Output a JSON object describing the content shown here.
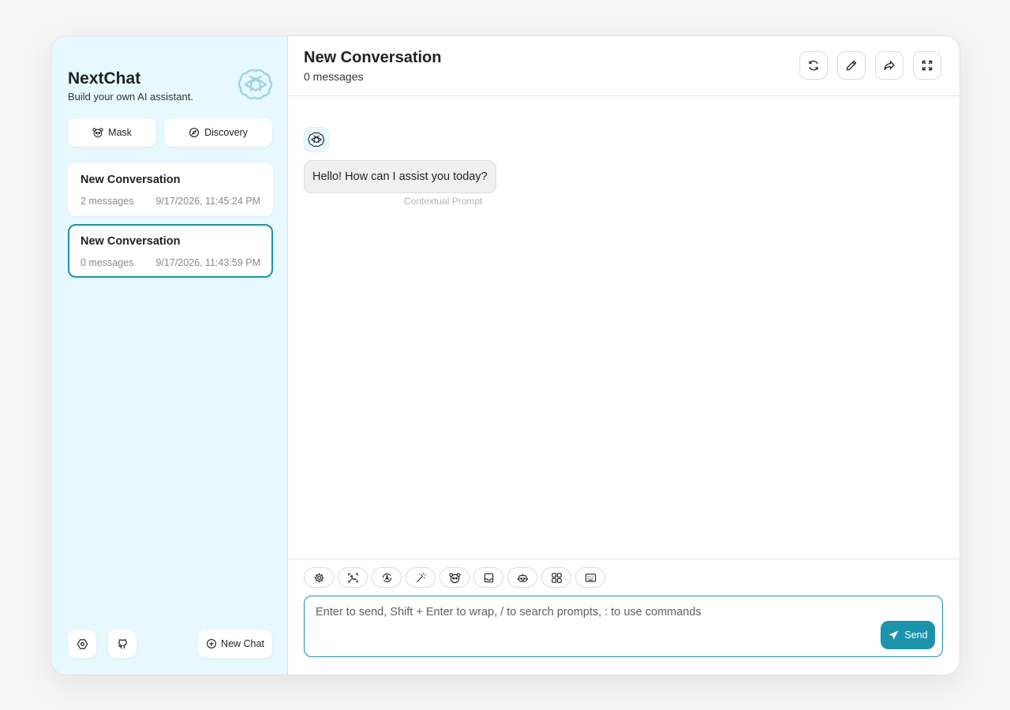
{
  "sidebar": {
    "brand_title": "NextChat",
    "brand_subtitle": "Build your own AI assistant.",
    "brand_icon": "openai-logo-icon",
    "mask_label": "Mask",
    "discovery_label": "Discovery",
    "chats": [
      {
        "title": "New Conversation",
        "count": "2 messages",
        "date": "9/17/2026, 11:45:24 PM",
        "selected": false
      },
      {
        "title": "New Conversation",
        "count": "0 messages",
        "date": "9/17/2026, 11:43:59 PM",
        "selected": true
      }
    ],
    "settings_icon": "settings-icon",
    "github_icon": "github-icon",
    "new_chat_label": "New Chat"
  },
  "header": {
    "title": "New Conversation",
    "subtitle": "0 messages",
    "buttons": [
      "refresh-icon",
      "edit-icon",
      "share-icon",
      "fullscreen-icon"
    ]
  },
  "messages": [
    {
      "role": "assistant",
      "text": "Hello! How can I assist you today?",
      "label": "Contextual Prompt"
    }
  ],
  "input": {
    "placeholder": "Enter to send, Shift + Enter to wrap, / to search prompts, : to use commands",
    "send_label": "Send",
    "toolbar": [
      "settings-icon",
      "image-icon",
      "auto-theme-icon",
      "prompt-magic-icon",
      "mask-icon",
      "clear-context-icon",
      "robot-icon",
      "plugin-icon",
      "shortcut-icon"
    ]
  },
  "colors": {
    "accent": "#1d93ab",
    "sidebar_bg": "#e7f8ff"
  }
}
